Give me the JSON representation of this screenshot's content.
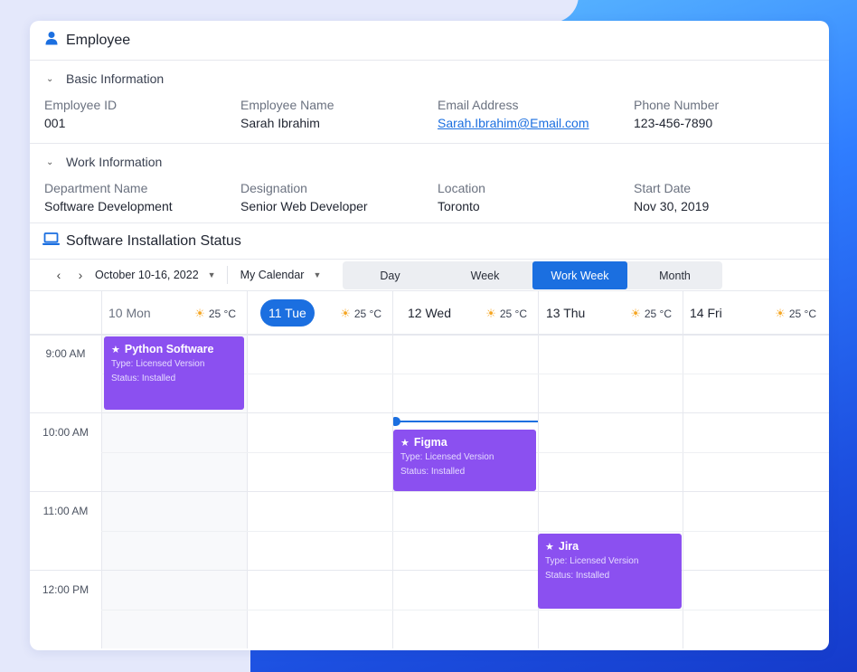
{
  "employee": {
    "title": "Employee",
    "basic": {
      "section_label": "Basic Information",
      "fields": [
        {
          "label": "Employee ID",
          "value": "001"
        },
        {
          "label": "Employee Name",
          "value": "Sarah Ibrahim"
        },
        {
          "label": "Email Address",
          "value": "Sarah.Ibrahim@Email.com"
        },
        {
          "label": "Phone Number",
          "value": "123-456-7890"
        }
      ]
    },
    "work": {
      "section_label": "Work Information",
      "fields": [
        {
          "label": "Department Name",
          "value": "Software Development"
        },
        {
          "label": "Designation",
          "value": "Senior Web Developer"
        },
        {
          "label": "Location",
          "value": "Toronto"
        },
        {
          "label": "Start Date",
          "value": "Nov 30, 2019"
        }
      ]
    }
  },
  "schedule": {
    "title": "Software Installation Status",
    "date_range": "October 10-16, 2022",
    "calendar_select": "My Calendar",
    "views": [
      "Day",
      "Week",
      "Work Week",
      "Month"
    ],
    "active_view": "Work Week",
    "days": [
      {
        "name": "10 Mon",
        "weather": "25 °C"
      },
      {
        "name": "11 Tue",
        "weather": "25 °C"
      },
      {
        "name": "12 Wed",
        "weather": "25 °C"
      },
      {
        "name": "13 Thu",
        "weather": "25 °C"
      },
      {
        "name": "14 Fri",
        "weather": "25 °C"
      }
    ],
    "times": [
      "9:00 AM",
      "10:00 AM",
      "11:00 AM",
      "12:00 PM"
    ],
    "events": [
      {
        "title": "Python Software",
        "type": "Type: Licensed Version",
        "status": "Status: Installed"
      },
      {
        "title": "Figma",
        "type": "Type: Licensed Version",
        "status": "Status: Installed"
      },
      {
        "title": "Jira",
        "type": "Type: Licensed Version",
        "status": "Status: Installed"
      }
    ]
  },
  "colors": {
    "accent": "#1b6fe0",
    "event": "#8b50f0"
  },
  "icons": {
    "employee": "person-icon",
    "schedule": "laptop-icon",
    "weather": "sun-icon",
    "event": "star-icon"
  }
}
